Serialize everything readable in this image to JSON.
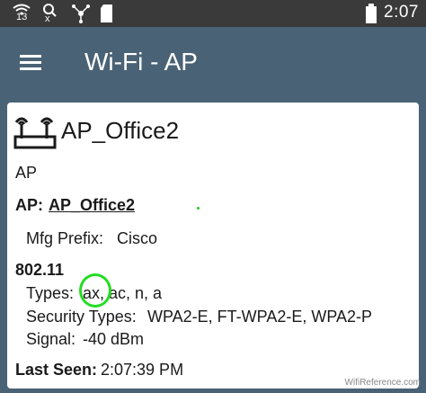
{
  "status_bar": {
    "time": "2:07",
    "icons": [
      "wifi-signal-icon",
      "search-x-icon",
      "share-icon",
      "sd-card-icon",
      "battery-icon"
    ],
    "wifi_badge": "13",
    "search_badge": "x"
  },
  "app_bar": {
    "title": "Wi-Fi - AP",
    "menu_icon": "hamburger-menu-icon"
  },
  "card": {
    "ap_name": "AP_Office2",
    "ap_icon": "access-point-icon",
    "type": "AP",
    "ap_label": "AP:",
    "ap_link": "AP_Office2",
    "mfg_prefix_label": "Mfg Prefix:",
    "mfg_prefix_value": "Cisco",
    "section_80211": "802.11",
    "types_label": "Types:",
    "types_value": "ax, ac, n, a",
    "security_label": "Security Types:",
    "security_value": "WPA2-E, FT-WPA2-E, WPA2-P",
    "signal_label": "Signal:",
    "signal_value": "-40 dBm",
    "last_seen_label": "Last Seen:",
    "last_seen_value": "2:07:39 PM"
  },
  "watermark": "WifiReference.com",
  "colors": {
    "app_bar": "#4a6275",
    "status_bar": "#3a3a3a",
    "link": "#2a6fc9",
    "highlight": "#22dd22"
  }
}
